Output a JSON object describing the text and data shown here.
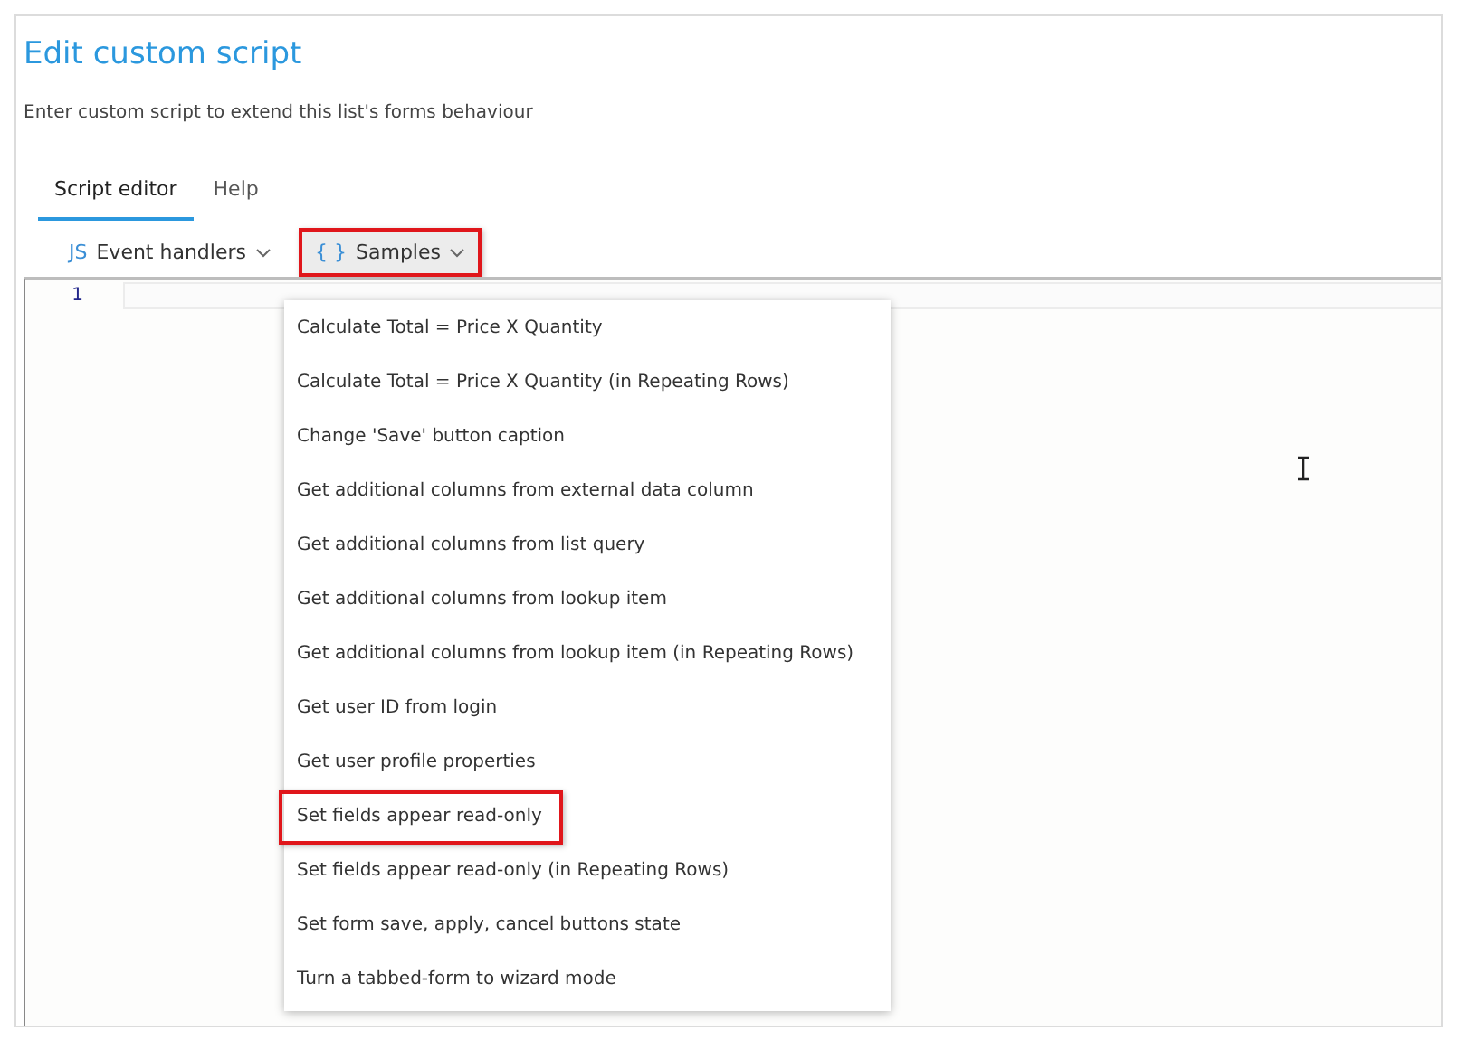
{
  "title": "Edit custom script",
  "description": "Enter custom script to extend this list's forms behaviour",
  "tabs": [
    {
      "label": "Script editor",
      "selected": true
    },
    {
      "label": "Help",
      "selected": false
    }
  ],
  "toolbar": [
    {
      "glyph": "JS",
      "label": "Event handlers",
      "highlighted": false,
      "expanded": false
    },
    {
      "glyph": "{ }",
      "label": "Samples",
      "highlighted": true,
      "expanded": true
    }
  ],
  "editor": {
    "line_numbers": [
      "1"
    ]
  },
  "samples_menu": [
    {
      "label": "Calculate Total = Price X Quantity",
      "highlighted": false
    },
    {
      "label": "Calculate Total = Price X Quantity (in Repeating Rows)",
      "highlighted": false
    },
    {
      "label": "Change 'Save' button caption",
      "highlighted": false
    },
    {
      "label": "Get additional columns from external data column",
      "highlighted": false
    },
    {
      "label": "Get additional columns from list query",
      "highlighted": false
    },
    {
      "label": "Get additional columns from lookup item",
      "highlighted": false
    },
    {
      "label": "Get additional columns from lookup item (in Repeating Rows)",
      "highlighted": false
    },
    {
      "label": "Get user ID from login",
      "highlighted": false
    },
    {
      "label": "Get user profile properties",
      "highlighted": false
    },
    {
      "label": "Set fields appear read-only",
      "highlighted": true
    },
    {
      "label": "Set fields appear read-only (in Repeating Rows)",
      "highlighted": false
    },
    {
      "label": "Set form save, apply, cancel buttons state",
      "highlighted": false
    },
    {
      "label": "Turn a tabbed-form to wizard mode",
      "highlighted": false
    }
  ]
}
